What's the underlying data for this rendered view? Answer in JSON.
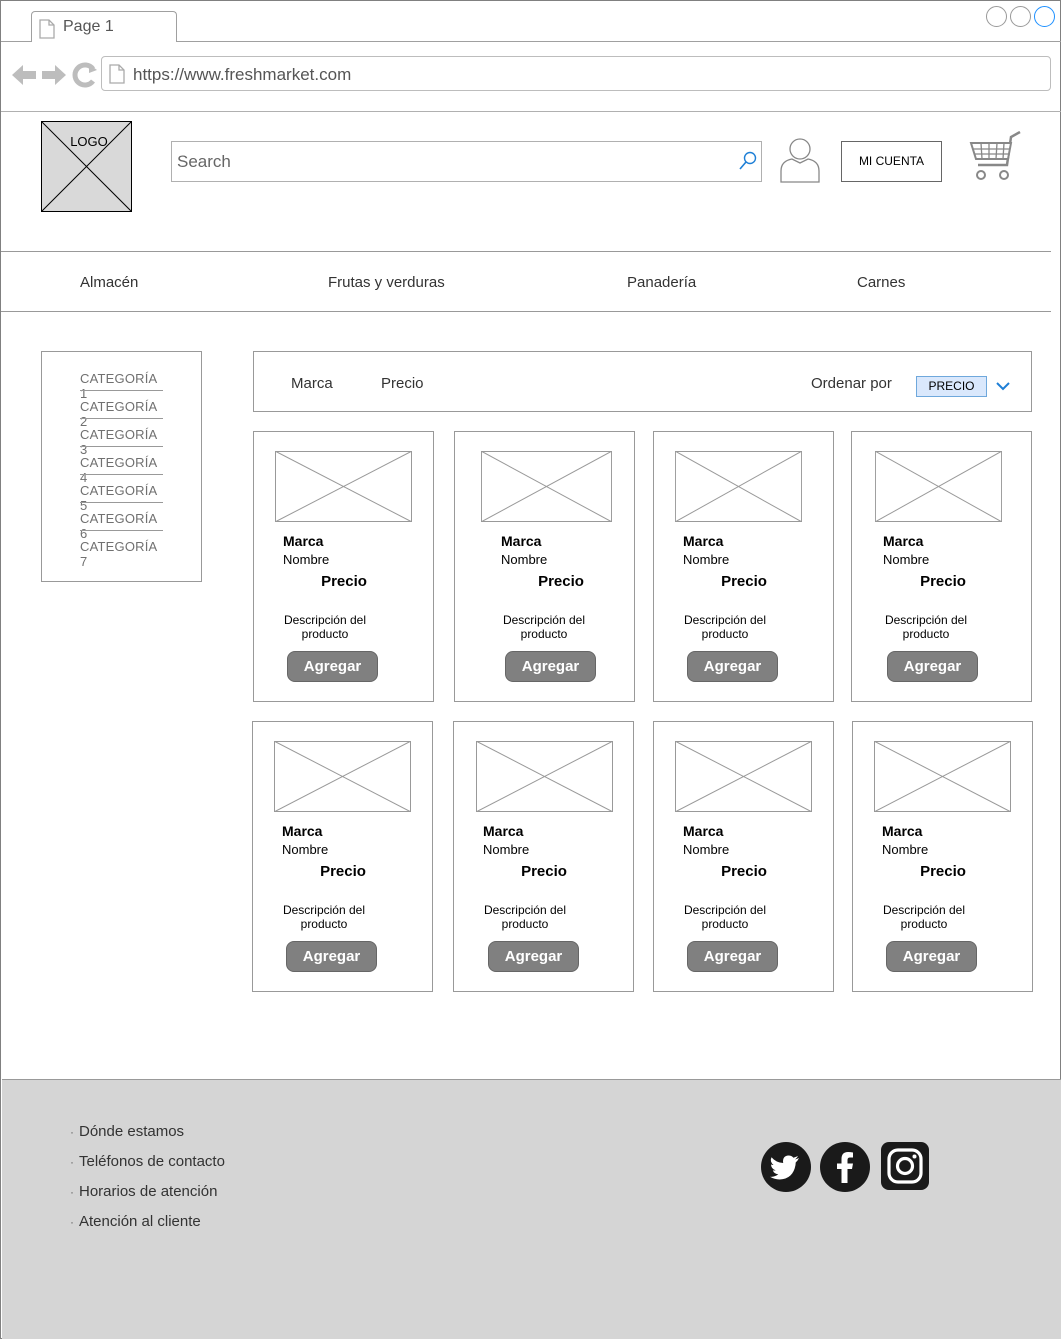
{
  "browser": {
    "tab_label": "Page 1",
    "url": "https://www.freshmarket.com"
  },
  "header": {
    "logo_text": "LOGO",
    "search_placeholder": "Search",
    "account_label": "MI CUENTA"
  },
  "nav": {
    "items": [
      {
        "label": "Almacén"
      },
      {
        "label": "Frutas y verduras"
      },
      {
        "label": "Panadería"
      },
      {
        "label": "Carnes"
      }
    ]
  },
  "sidebar": {
    "categories": [
      {
        "label": "CATEGORÍA 1"
      },
      {
        "label": "CATEGORÍA 2"
      },
      {
        "label": "CATEGORÍA 3"
      },
      {
        "label": "CATEGORÍA 4"
      },
      {
        "label": "CATEGORÍA 5"
      },
      {
        "label": "CATEGORÍA 6"
      },
      {
        "label": "CATEGORÍA 7"
      }
    ]
  },
  "filters": {
    "brand": "Marca",
    "price": "Precio",
    "sort_label": "Ordenar por",
    "sort_value": "PRECIO"
  },
  "products": [
    {
      "brand": "Marca",
      "name": "Nombre",
      "price": "Precio",
      "desc1": "Descripción del",
      "desc2": "producto",
      "button": "Agregar"
    },
    {
      "brand": "Marca",
      "name": "Nombre",
      "price": "Precio",
      "desc1": "Descripción del",
      "desc2": "producto",
      "button": "Agregar"
    },
    {
      "brand": "Marca",
      "name": "Nombre",
      "price": "Precio",
      "desc1": "Descripción del",
      "desc2": "producto",
      "button": "Agregar"
    },
    {
      "brand": "Marca",
      "name": "Nombre",
      "price": "Precio",
      "desc1": "Descripción del",
      "desc2": "producto",
      "button": "Agregar"
    },
    {
      "brand": "Marca",
      "name": "Nombre",
      "price": "Precio",
      "desc1": "Descripción del",
      "desc2": "producto",
      "button": "Agregar"
    },
    {
      "brand": "Marca",
      "name": "Nombre",
      "price": "Precio",
      "desc1": "Descripción del",
      "desc2": "producto",
      "button": "Agregar"
    },
    {
      "brand": "Marca",
      "name": "Nombre",
      "price": "Precio",
      "desc1": "Descripción del",
      "desc2": "producto",
      "button": "Agregar"
    },
    {
      "brand": "Marca",
      "name": "Nombre",
      "price": "Precio",
      "desc1": "Descripción del",
      "desc2": "producto",
      "button": "Agregar"
    }
  ],
  "footer": {
    "links": [
      {
        "label": "Dónde estamos"
      },
      {
        "label": "Teléfonos de contacto"
      },
      {
        "label": "Horarios de atención"
      },
      {
        "label": "Atención al cliente"
      }
    ],
    "social_icons": [
      "twitter-icon",
      "facebook-icon",
      "instagram-icon"
    ]
  },
  "colors": {
    "button_bg": "#808080",
    "sort_bg": "#dae8fc",
    "sort_border": "#6fa8dc",
    "chevron": "#1e7fd6",
    "footer_bg": "#d5d5d5",
    "social_bg": "#1a1a1a"
  }
}
